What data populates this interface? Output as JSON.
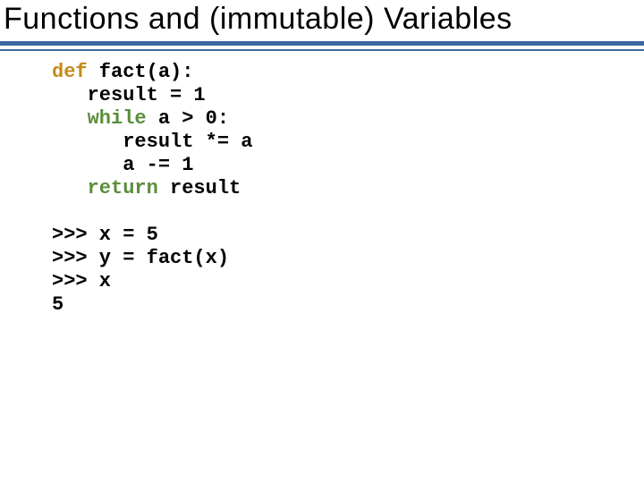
{
  "title": "Functions and (immutable) Variables",
  "code": {
    "kw_def": "def",
    "fn_sig": " fact(a):",
    "l2": "   result = 1",
    "kw_while": "while",
    "while_rest": " a > 0:",
    "l4": "      result *= a",
    "l5": "      a -= 1",
    "kw_return": "return",
    "return_rest": " result",
    "blank": "",
    "p1": ">>> x = 5",
    "p2": ">>> y = fact(x)",
    "p3": ">>> x",
    "out": "5"
  }
}
